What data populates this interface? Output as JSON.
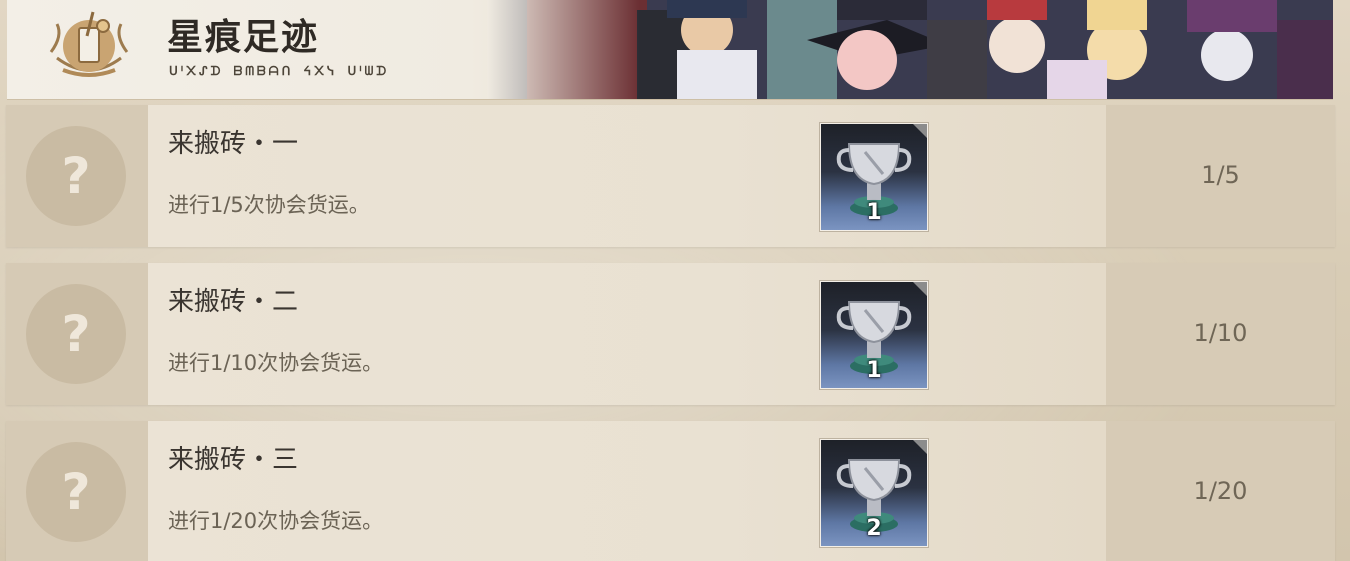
{
  "header": {
    "title": "星痕足迹",
    "subtitle": "ᑌᑊ᙭ᔑᗪ ᗷᗰᗷᗩᑎ ᔦ᙭ᓭ ᑌᑊᗯᗪ"
  },
  "achievements": [
    {
      "title": "来搬砖・一",
      "description": "进行1/5次协会货运。",
      "trophy_count": "1",
      "progress": "1/5",
      "placeholder": "?"
    },
    {
      "title": "来搬砖・二",
      "description": "进行1/10次协会货运。",
      "trophy_count": "1",
      "progress": "1/10",
      "placeholder": "?"
    },
    {
      "title": "来搬砖・三",
      "description": "进行1/20次协会货运。",
      "trophy_count": "2",
      "progress": "1/20",
      "placeholder": "?"
    }
  ],
  "icons": {
    "emblem": "drink-emblem-icon",
    "trophy": "silver-trophy-icon",
    "locked": "question-mark-icon"
  },
  "colors": {
    "card_bg": "#e7ddcc",
    "icon_column_bg": "#d6cab5",
    "progress_column_bg": "#d7cbb6",
    "trophy_bg_top": "#1e2128",
    "trophy_bg_bottom": "#7b94c1"
  }
}
